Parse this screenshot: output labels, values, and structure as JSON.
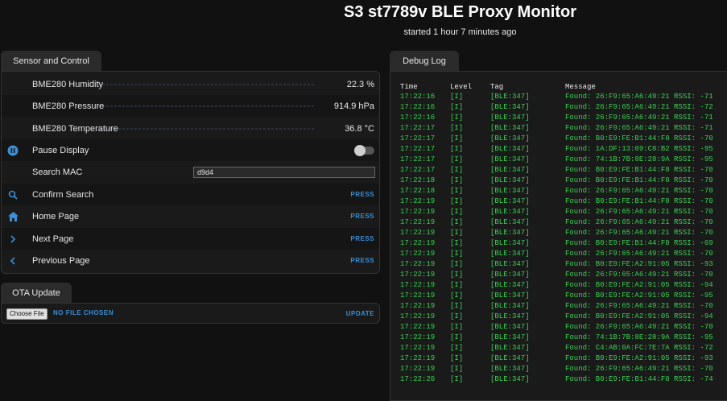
{
  "page": {
    "title": "S3 st7789v BLE Proxy Monitor",
    "subtitle": "started 1 hour 7 minutes ago"
  },
  "sensor_panel": {
    "tab_label": "Sensor and Control",
    "rows": [
      {
        "label": "BME280 Humidity",
        "value": "22.3 %"
      },
      {
        "label": "BME280 Pressure",
        "value": "914.9 hPa"
      },
      {
        "label": "BME280 Temperature",
        "value": "36.8 °C"
      },
      {
        "label": "Pause Display"
      },
      {
        "label": "Search MAC",
        "input_value": "d9d4"
      },
      {
        "label": "Confirm Search",
        "action": "PRESS"
      },
      {
        "label": "Home Page",
        "action": "PRESS"
      },
      {
        "label": "Next Page",
        "action": "PRESS"
      },
      {
        "label": "Previous Page",
        "action": "PRESS"
      }
    ]
  },
  "ota_panel": {
    "tab_label": "OTA Update",
    "choose_file": "Choose File",
    "no_file": "NO FILE CHOSEN",
    "update": "UPDATE"
  },
  "debug_panel": {
    "tab_label": "Debug Log",
    "columns": [
      "Time",
      "Level",
      "Tag",
      "Message"
    ],
    "rows": [
      [
        "17:22:16",
        "[I]",
        "[BLE:347]",
        "Found: 26:F9:65:A6:49:21 RSSI: -71"
      ],
      [
        "17:22:16",
        "[I]",
        "[BLE:347]",
        "Found: 26:F9:65:A6:49:21 RSSI: -72"
      ],
      [
        "17:22:16",
        "[I]",
        "[BLE:347]",
        "Found: 26:F9:65:A6:49:21 RSSI: -71"
      ],
      [
        "17:22:17",
        "[I]",
        "[BLE:347]",
        "Found: 26:F9:65:A6:49:21 RSSI: -71"
      ],
      [
        "17:22:17",
        "[I]",
        "[BLE:347]",
        "Found: B0:E9:FE:B1:44:F8 RSSI: -70"
      ],
      [
        "17:22:17",
        "[I]",
        "[BLE:347]",
        "Found: 1A:DF:13:09:C8:B2 RSSI: -95"
      ],
      [
        "17:22:17",
        "[I]",
        "[BLE:347]",
        "Found: 74:1B:7B:8E:28:9A RSSI: -95"
      ],
      [
        "17:22:17",
        "[I]",
        "[BLE:347]",
        "Found: B0:E9:FE:B1:44:F8 RSSI: -70"
      ],
      [
        "17:22:18",
        "[I]",
        "[BLE:347]",
        "Found: B0:E9:FE:B1:44:F8 RSSI: -70"
      ],
      [
        "17:22:18",
        "[I]",
        "[BLE:347]",
        "Found: 26:F9:65:A6:49:21 RSSI: -70"
      ],
      [
        "17:22:19",
        "[I]",
        "[BLE:347]",
        "Found: B0:E9:FE:B1:44:F8 RSSI: -70"
      ],
      [
        "17:22:19",
        "[I]",
        "[BLE:347]",
        "Found: 26:F9:65:A6:49:21 RSSI: -70"
      ],
      [
        "17:22:19",
        "[I]",
        "[BLE:347]",
        "Found: 26:F9:65:A6:49:21 RSSI: -70"
      ],
      [
        "17:22:19",
        "[I]",
        "[BLE:347]",
        "Found: 26:F9:65:A6:49:21 RSSI: -70"
      ],
      [
        "17:22:19",
        "[I]",
        "[BLE:347]",
        "Found: B0:E9:FE:B1:44:F8 RSSI: -69"
      ],
      [
        "17:22:19",
        "[I]",
        "[BLE:347]",
        "Found: 26:F9:65:A6:49:21 RSSI: -70"
      ],
      [
        "17:22:19",
        "[I]",
        "[BLE:347]",
        "Found: B0:E9:FE:A2:91:05 RSSI: -93"
      ],
      [
        "17:22:19",
        "[I]",
        "[BLE:347]",
        "Found: 26:F9:65:A6:49:21 RSSI: -70"
      ],
      [
        "17:22:19",
        "[I]",
        "[BLE:347]",
        "Found: B0:E9:FE:A2:91:05 RSSI: -94"
      ],
      [
        "17:22:19",
        "[I]",
        "[BLE:347]",
        "Found: B0:E9:FE:A2:91:05 RSSI: -95"
      ],
      [
        "17:22:19",
        "[I]",
        "[BLE:347]",
        "Found: 26:F9:65:A6:49:21 RSSI: -70"
      ],
      [
        "17:22:19",
        "[I]",
        "[BLE:347]",
        "Found: B0:E9:FE:A2:91:05 RSSI: -94"
      ],
      [
        "17:22:19",
        "[I]",
        "[BLE:347]",
        "Found: 26:F9:65:A6:49:21 RSSI: -70"
      ],
      [
        "17:22:19",
        "[I]",
        "[BLE:347]",
        "Found: 74:1B:7B:8E:28:9A RSSI: -95"
      ],
      [
        "17:22:19",
        "[I]",
        "[BLE:347]",
        "Found: C4:AB:0A:FC:7E:7A RSSI: -72"
      ],
      [
        "17:22:19",
        "[I]",
        "[BLE:347]",
        "Found: B0:E9:FE:A2:91:05 RSSI: -93"
      ],
      [
        "17:22:19",
        "[I]",
        "[BLE:347]",
        "Found: 26:F9:65:A6:49:21 RSSI: -70"
      ],
      [
        "17:22:20",
        "[I]",
        "[BLE:347]",
        "Found: B0:E9:FE:B1:44:F8 RSSI: -74"
      ]
    ]
  },
  "colors": {
    "accent": "#3a8fd6",
    "log_text": "#39d353",
    "background": "#111111"
  },
  "icons": [
    "pause-icon",
    "search-icon",
    "home-icon",
    "chevron-right-icon",
    "chevron-left-icon"
  ]
}
